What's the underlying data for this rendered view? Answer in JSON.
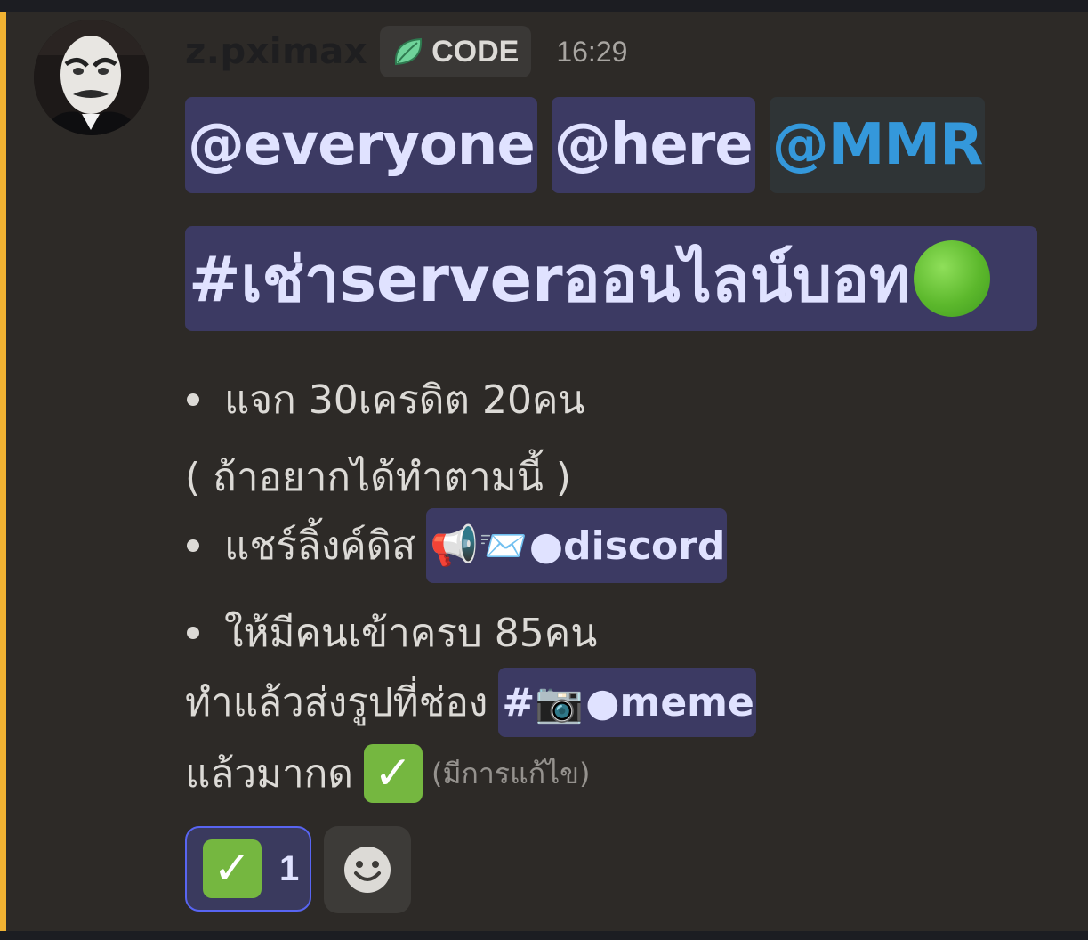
{
  "message": {
    "username": "z.pximax",
    "role_tag": "CODE",
    "timestamp": "16:29",
    "mentions": [
      "@everyone",
      "@here",
      "@MMR"
    ],
    "channel_title": "#เช่าserverออนไลน์บอท",
    "bullet_1": "แจก 30เครดิต 20คน",
    "note": "( ถ้าอยากได้ทำตามนี้ )",
    "bullet_2": "แชร์ลิ้งค์ดิส",
    "channel_discord": {
      "emoji": "📢📨",
      "name": "●discord"
    },
    "bullet_3": "ให้มีคนเข้าครบ 85คน",
    "send_line": "ทำแล้วส่งรูปที่ช่อง",
    "channel_meme": {
      "hash": "#",
      "emoji": "📷",
      "name": "●meme"
    },
    "final_line": "แล้วมากด",
    "check": "✓",
    "edited": "(มีการแก้ไข)"
  },
  "reactions": [
    {
      "emoji": "✓",
      "count": "1",
      "selected": true
    }
  ],
  "colors": {
    "background": "#2d2a27",
    "highlight": "#f0b232",
    "mention_bg": "#3c3a63",
    "role_mention": "#3498db",
    "check_green": "#75b740"
  }
}
